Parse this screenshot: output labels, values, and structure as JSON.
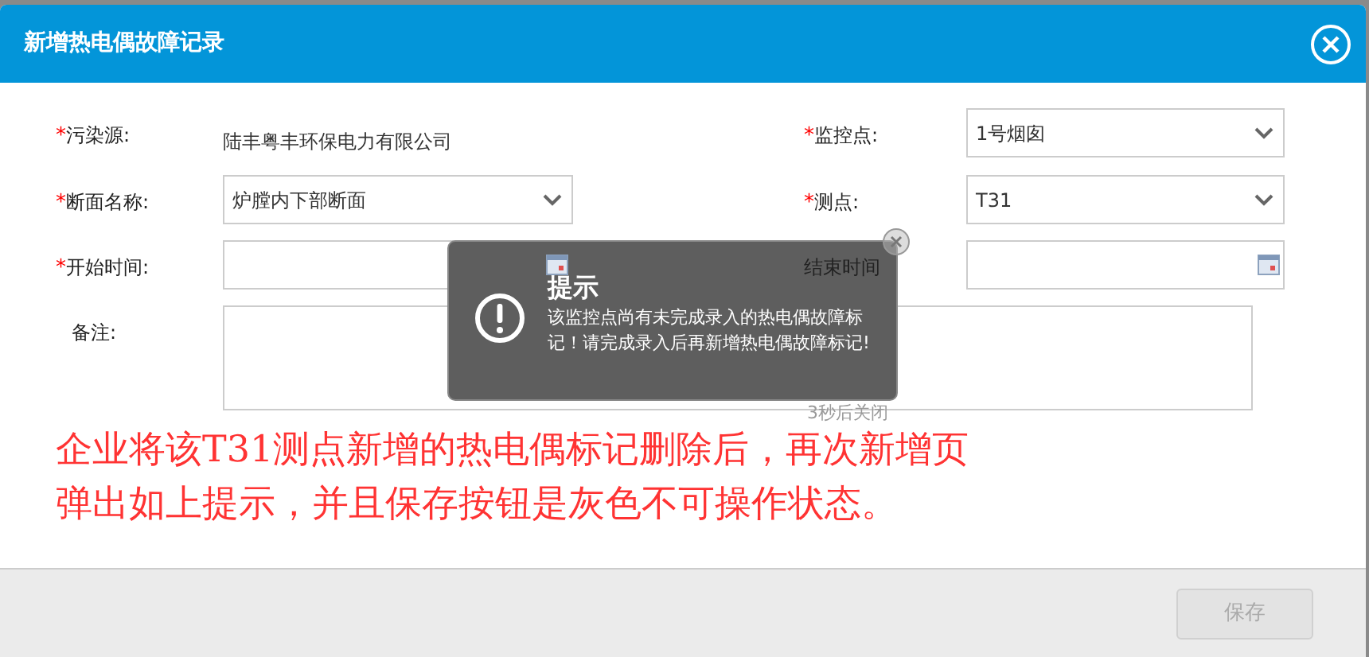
{
  "dialog": {
    "title": "新增热电偶故障记录"
  },
  "fields": [
    {
      "kind": "text",
      "label": "污染源:",
      "marker": "*",
      "value": "陆丰粤丰环保电力有限公司"
    },
    {
      "kind": "select",
      "label": "监控点:",
      "marker": "*",
      "value": "1号烟囱"
    },
    {
      "kind": "select",
      "label": "断面名称:",
      "marker": "*",
      "value": "炉膛内下部断面"
    },
    {
      "kind": "select",
      "label": "测点:",
      "marker": "*",
      "value": "T31"
    },
    {
      "kind": "date",
      "label": "开始时间:",
      "marker": "*"
    },
    {
      "kind": "date",
      "label": "结束时间"
    },
    {
      "kind": "textarea",
      "label": "备注:"
    }
  ],
  "toast": {
    "title": "提示",
    "message": "该监控点尚有未完成录入的热电偶故障标记！请完成录入后再新增热电偶故障标记!",
    "countdown": "3秒后关闭"
  },
  "annotation": [
    "企业将该T31测点新增的热电偶标记删除后，再次新增页",
    "弹出如上提示，并且保存按钮是灰色不可操作状态。"
  ],
  "footer": {
    "save_button": {
      "label": "保存",
      "disabled": true
    }
  }
}
